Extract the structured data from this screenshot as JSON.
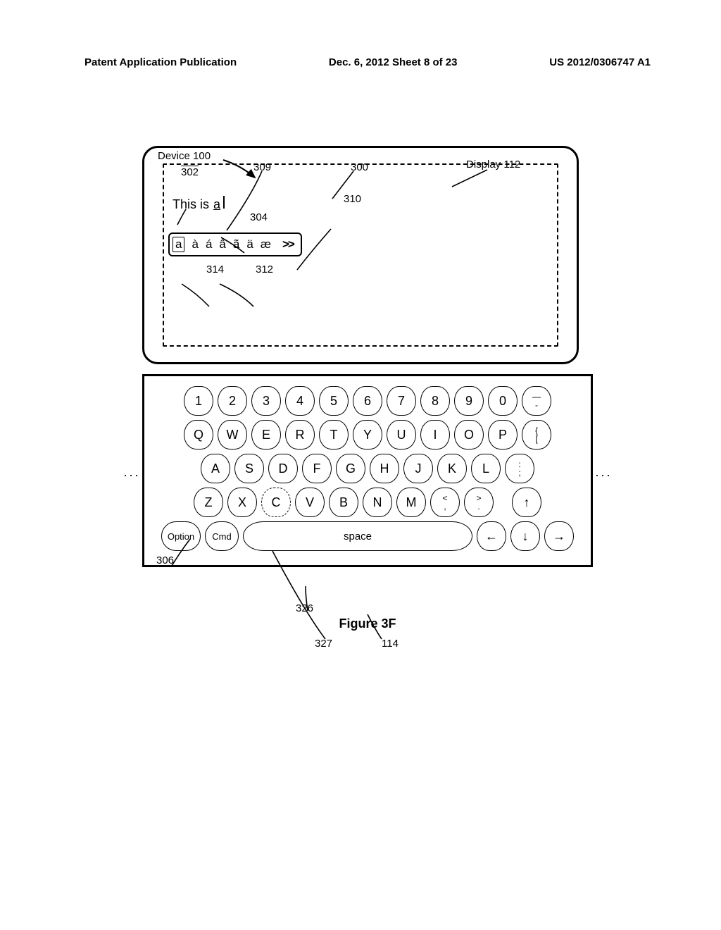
{
  "header": {
    "left": "Patent Application Publication",
    "center": "Dec. 6, 2012  Sheet 8 of 23",
    "right": "US 2012/0306747 A1"
  },
  "labels": {
    "device": "Device 100",
    "display_ref": "Display 112",
    "r300": "300",
    "r302": "302",
    "r304": "304",
    "r306": "306",
    "r309": "309",
    "r310": "310",
    "r312": "312",
    "r314": "314",
    "r326": "326",
    "r327": "327",
    "r114": "114"
  },
  "text_area": {
    "typed_prefix": "This is",
    "typed_char": "a"
  },
  "accent_popup": {
    "selected": "a",
    "options": [
      "à",
      "á",
      "â",
      "ã",
      "ä",
      "æ"
    ],
    "more": ">>"
  },
  "keyboard": {
    "row1": [
      "1",
      "2",
      "3",
      "4",
      "5",
      "6",
      "7",
      "8",
      "9",
      "0"
    ],
    "row1_end": {
      "top": "—",
      "bot": "-"
    },
    "row2": [
      "Q",
      "W",
      "E",
      "R",
      "T",
      "Y",
      "U",
      "I",
      "O",
      "P"
    ],
    "row2_end": {
      "top": "{",
      "bot": "["
    },
    "row3": [
      "A",
      "S",
      "D",
      "F",
      "G",
      "H",
      "J",
      "K",
      "L"
    ],
    "row3_end": {
      "top": ":",
      "bot": ";"
    },
    "row4": [
      "Z",
      "X",
      "C",
      "V",
      "B",
      "N",
      "M"
    ],
    "row4_lt": {
      "top": "<",
      "bot": ","
    },
    "row4_gt": {
      "top": ">",
      "bot": "."
    },
    "row5": {
      "option": "Option",
      "cmd": "Cmd",
      "space": "space"
    },
    "arrows": {
      "up": "↑",
      "left": "←",
      "down": "↓",
      "right": "→"
    }
  },
  "figure_caption": "Figure 3F"
}
